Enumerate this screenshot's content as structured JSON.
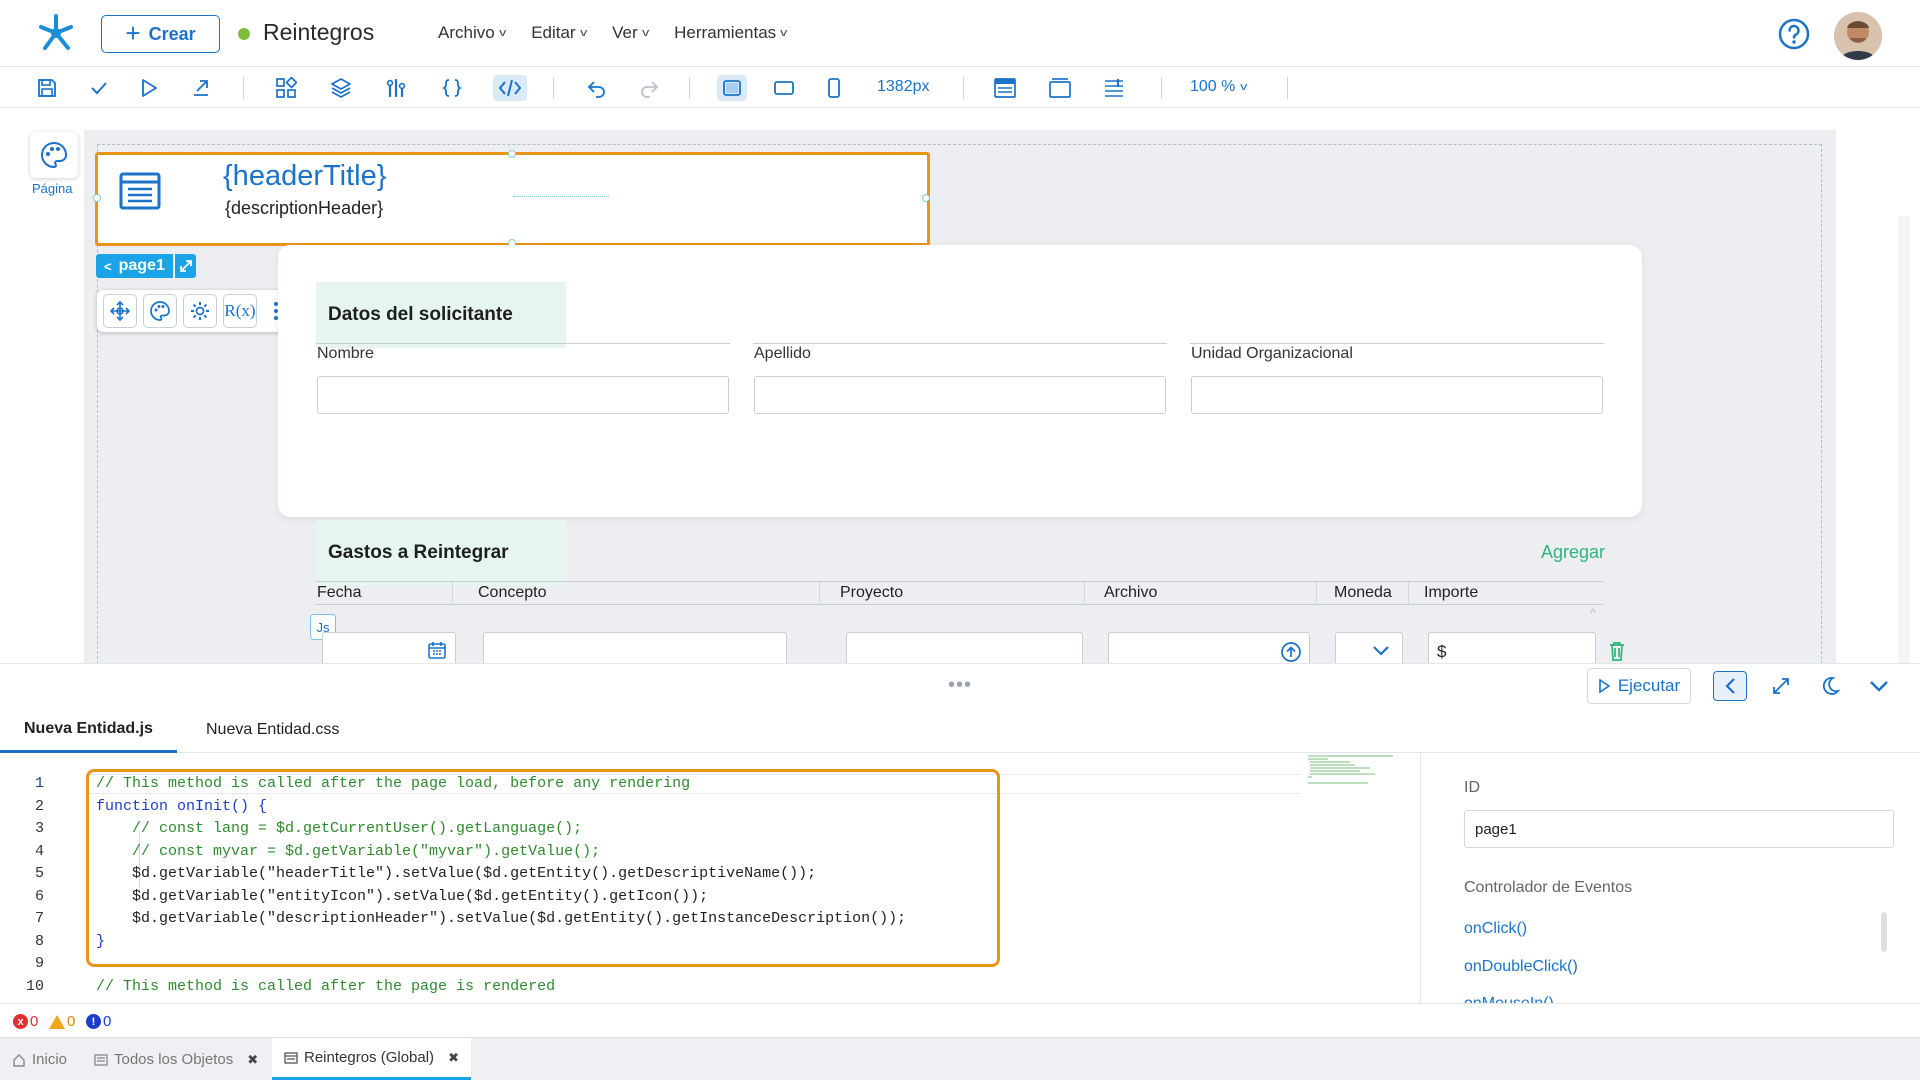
{
  "header": {
    "create_label": "Crear",
    "doc_title": "Reintegros",
    "menu": [
      "Archivo",
      "Editar",
      "Ver",
      "Herramientas"
    ]
  },
  "toolbar": {
    "width_value": "1382px",
    "zoom_value": "100 %"
  },
  "canvas": {
    "page_tool_label": "Página",
    "header_title": "{headerTitle}",
    "header_desc": "{descriptionHeader}",
    "page_tag": "page1",
    "section1": {
      "title": "Datos del solicitante",
      "fields": [
        "Nombre",
        "Apellido",
        "Unidad Organizacional"
      ]
    },
    "section2": {
      "title": "Gastos a Reintegrar",
      "add_label": "Agregar",
      "columns": [
        "Fecha",
        "Concepto",
        "Proyecto",
        "Archivo",
        "Moneda",
        "Importe"
      ],
      "currency_symbol": "$",
      "js_chip": "Js"
    },
    "float_tools_rx": "R(x)"
  },
  "editor": {
    "run_label": "Ejecutar",
    "tabs": [
      "Nueva Entidad.js",
      "Nueva Entidad.css"
    ],
    "line_numbers": [
      "1",
      "2",
      "3",
      "4",
      "5",
      "6",
      "7",
      "8",
      "9",
      "10"
    ],
    "lines": [
      "// This method is called after the page load, before any rendering",
      "function onInit() {",
      "    // const lang = $d.getCurrentUser().getLanguage();",
      "    // const myvar = $d.getVariable(\"myvar\").getValue();",
      "    $d.getVariable(\"headerTitle\").setValue($d.getEntity().getDescriptiveName());",
      "    $d.getVariable(\"entityIcon\").setValue($d.getEntity().getIcon());",
      "    $d.getVariable(\"descriptionHeader\").setValue($d.getEntity().getInstanceDescription());",
      "}",
      "",
      "// This method is called after the page is rendered"
    ]
  },
  "properties": {
    "id_label": "ID",
    "id_value": "page1",
    "events_label": "Controlador de Eventos",
    "events": [
      "onClick()",
      "onDoubleClick()",
      "onMouseIn()"
    ]
  },
  "status": {
    "errors": "0",
    "warnings": "0",
    "infos": "0"
  },
  "bottom_tabs": {
    "home": "Inicio",
    "all_objects": "Todos los Objetos",
    "current": "Reintegros (Global)"
  },
  "colors": {
    "accent": "#1a73c9",
    "highlight": "#e8951a",
    "section_bg": "#e6f5ef",
    "add_link": "#2fb57a"
  }
}
